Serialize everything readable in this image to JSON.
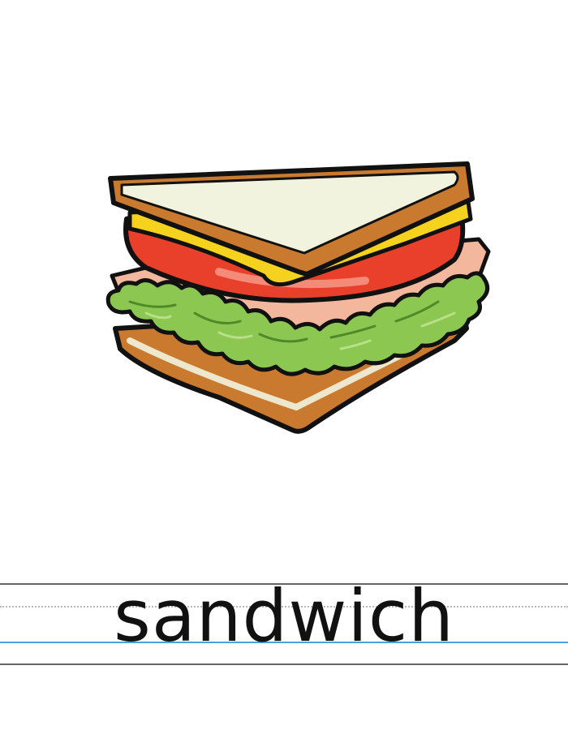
{
  "card": {
    "word": "sandwich",
    "image": "sandwich-illustration"
  },
  "colors": {
    "bread_crust": "#c97a2e",
    "bread_inside": "#f1f3df",
    "tomato": "#e8402a",
    "cheese": "#f5d21e",
    "lettuce": "#8cc752",
    "ham": "#f2b79c",
    "outline": "#111111",
    "guide_line": "#666666",
    "guide_dotted": "#b8b8b8",
    "guide_baseline": "#4aa3d8"
  }
}
